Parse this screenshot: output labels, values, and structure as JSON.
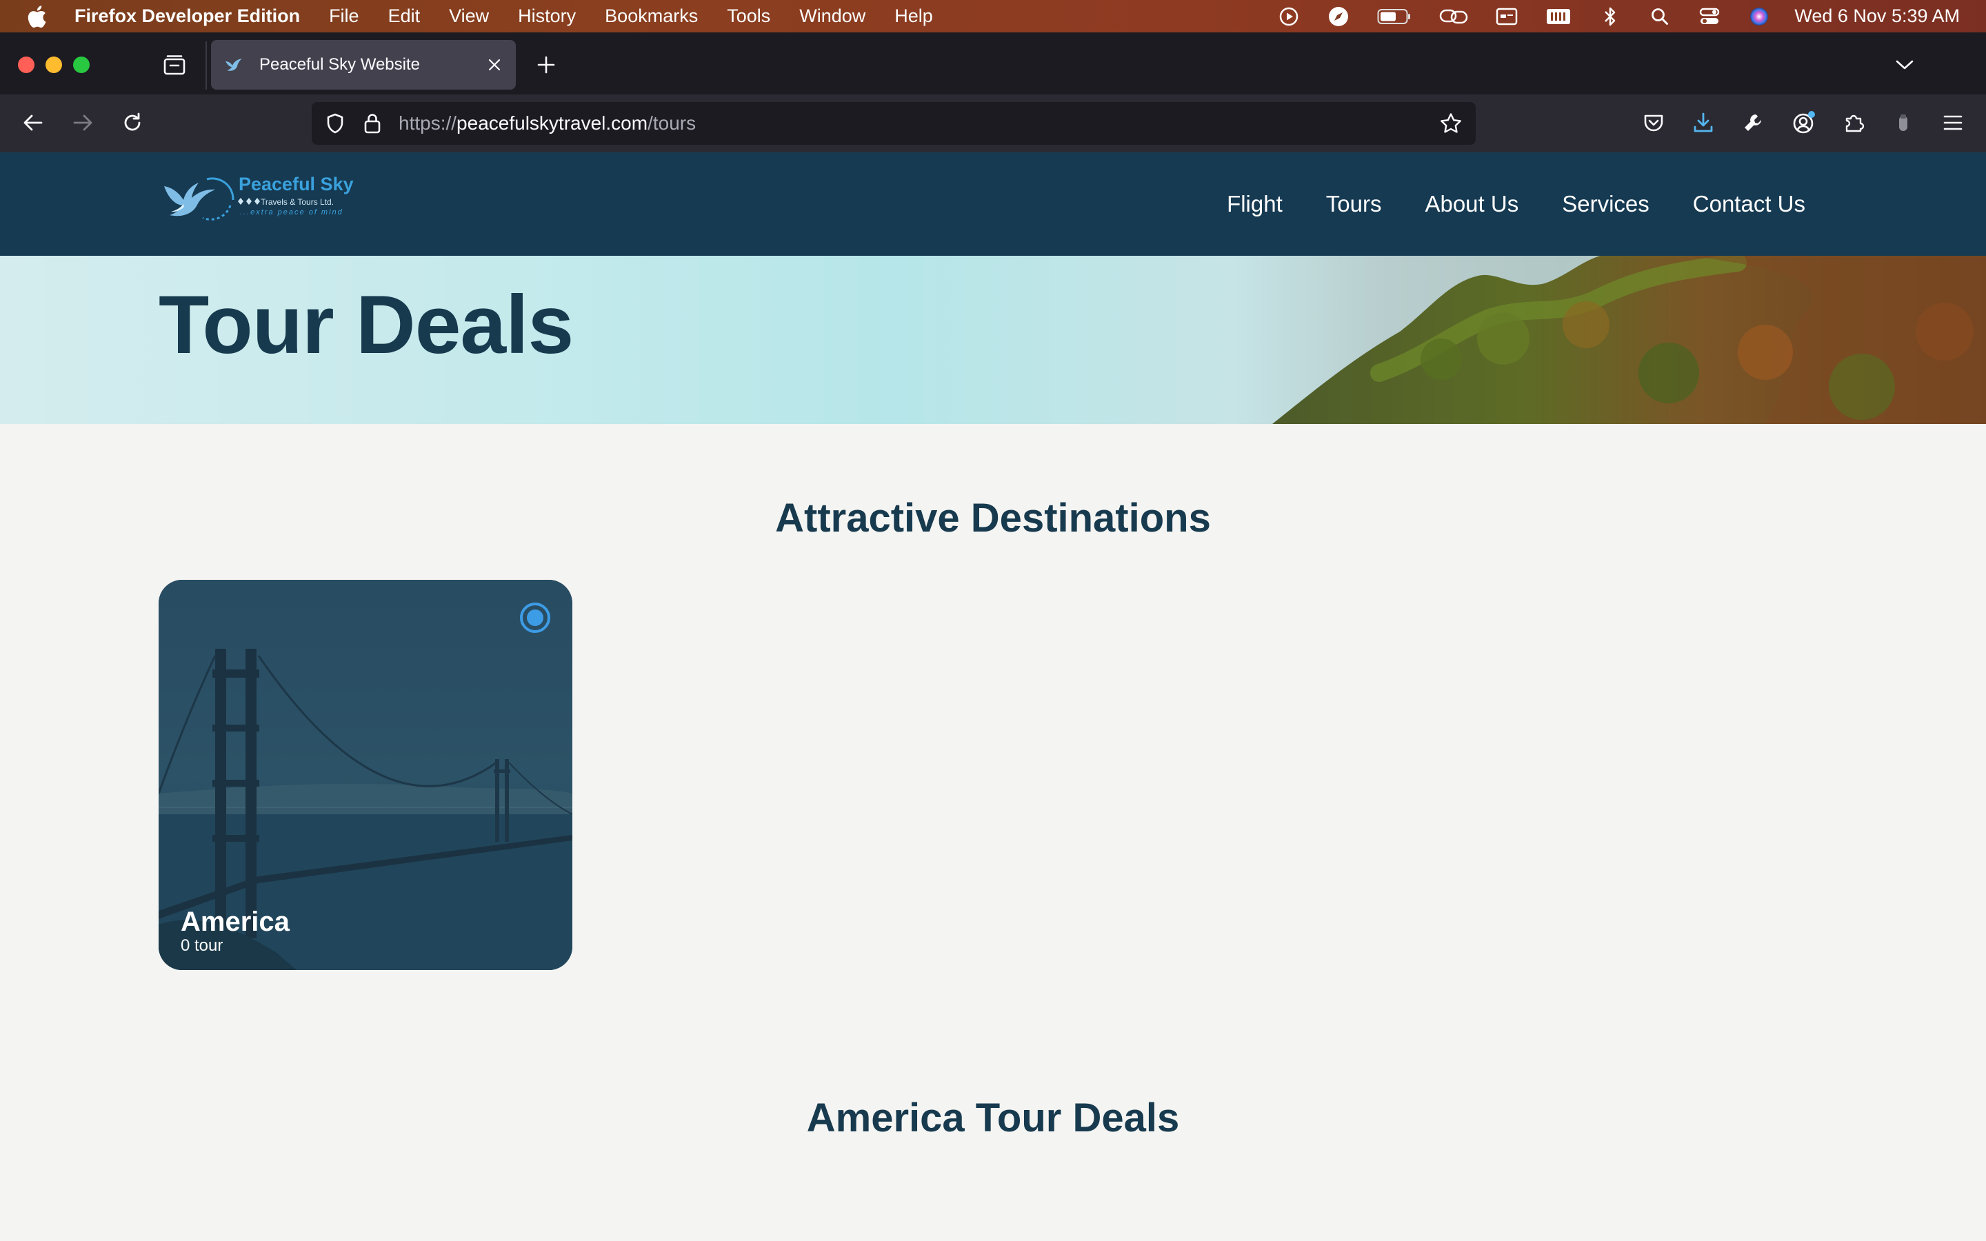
{
  "menubar": {
    "app_name": "Firefox Developer Edition",
    "items": [
      "File",
      "Edit",
      "View",
      "History",
      "Bookmarks",
      "Tools",
      "Window",
      "Help"
    ],
    "clock": "Wed 6 Nov  5:39 AM"
  },
  "browser": {
    "tab_title": "Peaceful Sky Website",
    "url_scheme": "https://",
    "url_host": "peacefulskytravel.com",
    "url_path": "/tours"
  },
  "site": {
    "logo": {
      "brand": "Peaceful Sky",
      "sub": "Travels & Tours Ltd.",
      "tagline": "...extra peace of mind"
    },
    "nav": [
      "Flight",
      "Tours",
      "About Us",
      "Services",
      "Contact Us"
    ],
    "hero_title": "Tour Deals",
    "destinations_title": "Attractive Destinations",
    "destinations": [
      {
        "name": "America",
        "count": "0 tour"
      }
    ],
    "deals_title": "America Tour Deals"
  },
  "colors": {
    "header_bg": "#163a52",
    "heading": "#173a4e",
    "accent": "#3d9ce6",
    "page_bg": "#f4f4f2"
  }
}
